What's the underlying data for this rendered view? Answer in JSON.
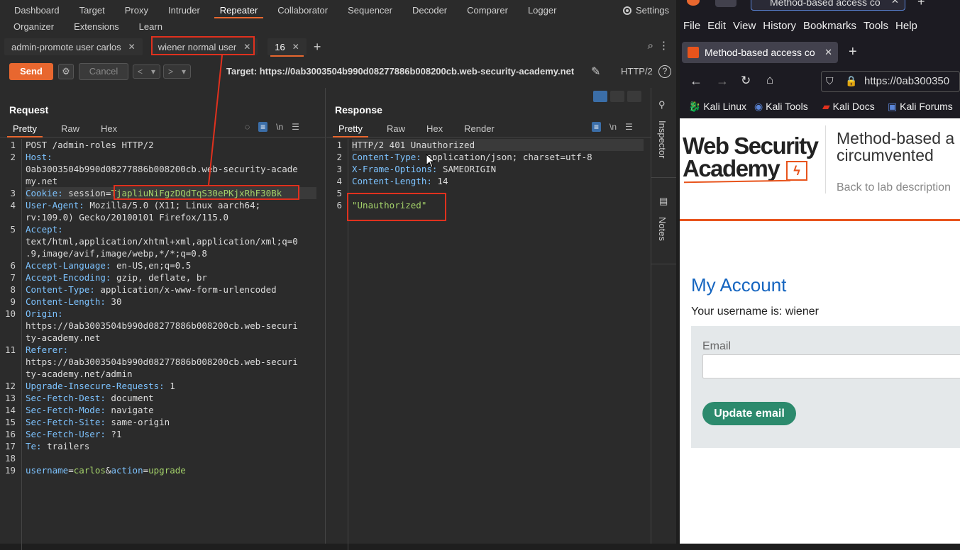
{
  "nav_row1": [
    "Dashboard",
    "Target",
    "Proxy",
    "Intruder",
    "Repeater",
    "Collaborator",
    "Sequencer",
    "Decoder",
    "Comparer",
    "Logger"
  ],
  "nav_row2": [
    "Organizer",
    "Extensions",
    "Learn"
  ],
  "settings_label": "Settings",
  "tabs": [
    "admin-promote user carlos",
    "wiener normal user",
    "16"
  ],
  "toolbar": {
    "send": "Send",
    "cancel": "Cancel",
    "target": "Target: https://0ab3003504b990d08277886b008200cb.web-security-academy.net",
    "http_version": "HTTP/2"
  },
  "request": {
    "title": "Request",
    "subtabs": [
      "Pretty",
      "Raw",
      "Hex"
    ],
    "newline_label": "\\n"
  },
  "response": {
    "title": "Response",
    "subtabs": [
      "Pretty",
      "Raw",
      "Hex",
      "Render"
    ],
    "newline_label": "\\n"
  },
  "request_lines": [
    {
      "n": "1",
      "parts": [
        [
          "plain",
          "POST /admin-roles HTTP/2"
        ]
      ]
    },
    {
      "n": "2",
      "parts": [
        [
          "key",
          "Host:"
        ]
      ]
    },
    {
      "n": "",
      "parts": [
        [
          "plain",
          "0ab3003504b990d08277886b008200cb.web-security-acade"
        ]
      ]
    },
    {
      "n": "",
      "parts": [
        [
          "plain",
          "my.net"
        ]
      ]
    },
    {
      "n": "3",
      "parts": [
        [
          "key",
          "Cookie: "
        ],
        [
          "plain",
          "session="
        ],
        [
          "green",
          "TjapliuNiFgzDQdTqS30ePKjxRhF30Bk"
        ]
      ]
    },
    {
      "n": "4",
      "parts": [
        [
          "key",
          "User-Agent: "
        ],
        [
          "plain",
          "Mozilla/5.0 (X11; Linux aarch64;"
        ]
      ]
    },
    {
      "n": "",
      "parts": [
        [
          "plain",
          "rv:109.0) Gecko/20100101 Firefox/115.0"
        ]
      ]
    },
    {
      "n": "5",
      "parts": [
        [
          "key",
          "Accept:"
        ]
      ]
    },
    {
      "n": "",
      "parts": [
        [
          "plain",
          "text/html,application/xhtml+xml,application/xml;q=0"
        ]
      ]
    },
    {
      "n": "",
      "parts": [
        [
          "plain",
          ".9,image/avif,image/webp,*/*;q=0.8"
        ]
      ]
    },
    {
      "n": "6",
      "parts": [
        [
          "key",
          "Accept-Language: "
        ],
        [
          "plain",
          "en-US,en;q=0.5"
        ]
      ]
    },
    {
      "n": "7",
      "parts": [
        [
          "key",
          "Accept-Encoding: "
        ],
        [
          "plain",
          "gzip, deflate, br"
        ]
      ]
    },
    {
      "n": "8",
      "parts": [
        [
          "key",
          "Content-Type: "
        ],
        [
          "plain",
          "application/x-www-form-urlencoded"
        ]
      ]
    },
    {
      "n": "9",
      "parts": [
        [
          "key",
          "Content-Length: "
        ],
        [
          "plain",
          "30"
        ]
      ]
    },
    {
      "n": "10",
      "parts": [
        [
          "key",
          "Origin:"
        ]
      ]
    },
    {
      "n": "",
      "parts": [
        [
          "plain",
          "https://0ab3003504b990d08277886b008200cb.web-securi"
        ]
      ]
    },
    {
      "n": "",
      "parts": [
        [
          "plain",
          "ty-academy.net"
        ]
      ]
    },
    {
      "n": "11",
      "parts": [
        [
          "key",
          "Referer:"
        ]
      ]
    },
    {
      "n": "",
      "parts": [
        [
          "plain",
          "https://0ab3003504b990d08277886b008200cb.web-securi"
        ]
      ]
    },
    {
      "n": "",
      "parts": [
        [
          "plain",
          "ty-academy.net/admin"
        ]
      ]
    },
    {
      "n": "12",
      "parts": [
        [
          "key",
          "Upgrade-Insecure-Requests: "
        ],
        [
          "plain",
          "1"
        ]
      ]
    },
    {
      "n": "13",
      "parts": [
        [
          "key",
          "Sec-Fetch-Dest: "
        ],
        [
          "plain",
          "document"
        ]
      ]
    },
    {
      "n": "14",
      "parts": [
        [
          "key",
          "Sec-Fetch-Mode: "
        ],
        [
          "plain",
          "navigate"
        ]
      ]
    },
    {
      "n": "15",
      "parts": [
        [
          "key",
          "Sec-Fetch-Site: "
        ],
        [
          "plain",
          "same-origin"
        ]
      ]
    },
    {
      "n": "16",
      "parts": [
        [
          "key",
          "Sec-Fetch-User: "
        ],
        [
          "plain",
          "?1"
        ]
      ]
    },
    {
      "n": "17",
      "parts": [
        [
          "key",
          "Te: "
        ],
        [
          "plain",
          "trailers"
        ]
      ]
    },
    {
      "n": "18",
      "parts": []
    },
    {
      "n": "19",
      "parts": [
        [
          "key",
          "username"
        ],
        [
          "plain",
          "="
        ],
        [
          "green",
          "carlos"
        ],
        [
          "plain",
          "&"
        ],
        [
          "key",
          "action"
        ],
        [
          "plain",
          "="
        ],
        [
          "green",
          "upgrade"
        ]
      ]
    }
  ],
  "response_lines": [
    {
      "n": "1",
      "parts": [
        [
          "plain",
          "HTTP/2 401 Unauthorized"
        ]
      ]
    },
    {
      "n": "2",
      "parts": [
        [
          "key",
          "Content-Type: "
        ],
        [
          "plain",
          "application/json; charset=utf-8"
        ]
      ]
    },
    {
      "n": "3",
      "parts": [
        [
          "key",
          "X-Frame-Options: "
        ],
        [
          "plain",
          "SAMEORIGIN"
        ]
      ]
    },
    {
      "n": "4",
      "parts": [
        [
          "key",
          "Content-Length: "
        ],
        [
          "plain",
          "14"
        ]
      ]
    },
    {
      "n": "5",
      "parts": []
    },
    {
      "n": "6",
      "parts": [
        [
          "green",
          "\"Unauthorized\""
        ]
      ]
    }
  ],
  "sidebar": {
    "inspector": "Inspector",
    "notes": "Notes"
  },
  "firefox": {
    "window_title": "Method-based access co",
    "menu": [
      "File",
      "Edit",
      "View",
      "History",
      "Bookmarks",
      "Tools",
      "Help"
    ],
    "tab_title": "Method-based access co",
    "url": "https://0ab300350",
    "bookmarks": [
      "Kali Linux",
      "Kali Tools",
      "Kali Docs",
      "Kali Forums"
    ],
    "logo_line1": "Web Security",
    "logo_line2": "Academy",
    "lab_title": "Method-based a circumvented",
    "lab_title_l1": "Method-based a",
    "lab_title_l2": "circumvented",
    "back_link": "Back to lab description",
    "heading": "My Account",
    "username_text": "Your username is: wiener",
    "email_label": "Email",
    "update_button": "Update email"
  },
  "colors": {
    "accent": "#e8672f",
    "highlight_box": "#e0311e",
    "academy_orange": "#e8541c",
    "link_blue": "#1565c0",
    "button_green": "#2c8a6d"
  }
}
